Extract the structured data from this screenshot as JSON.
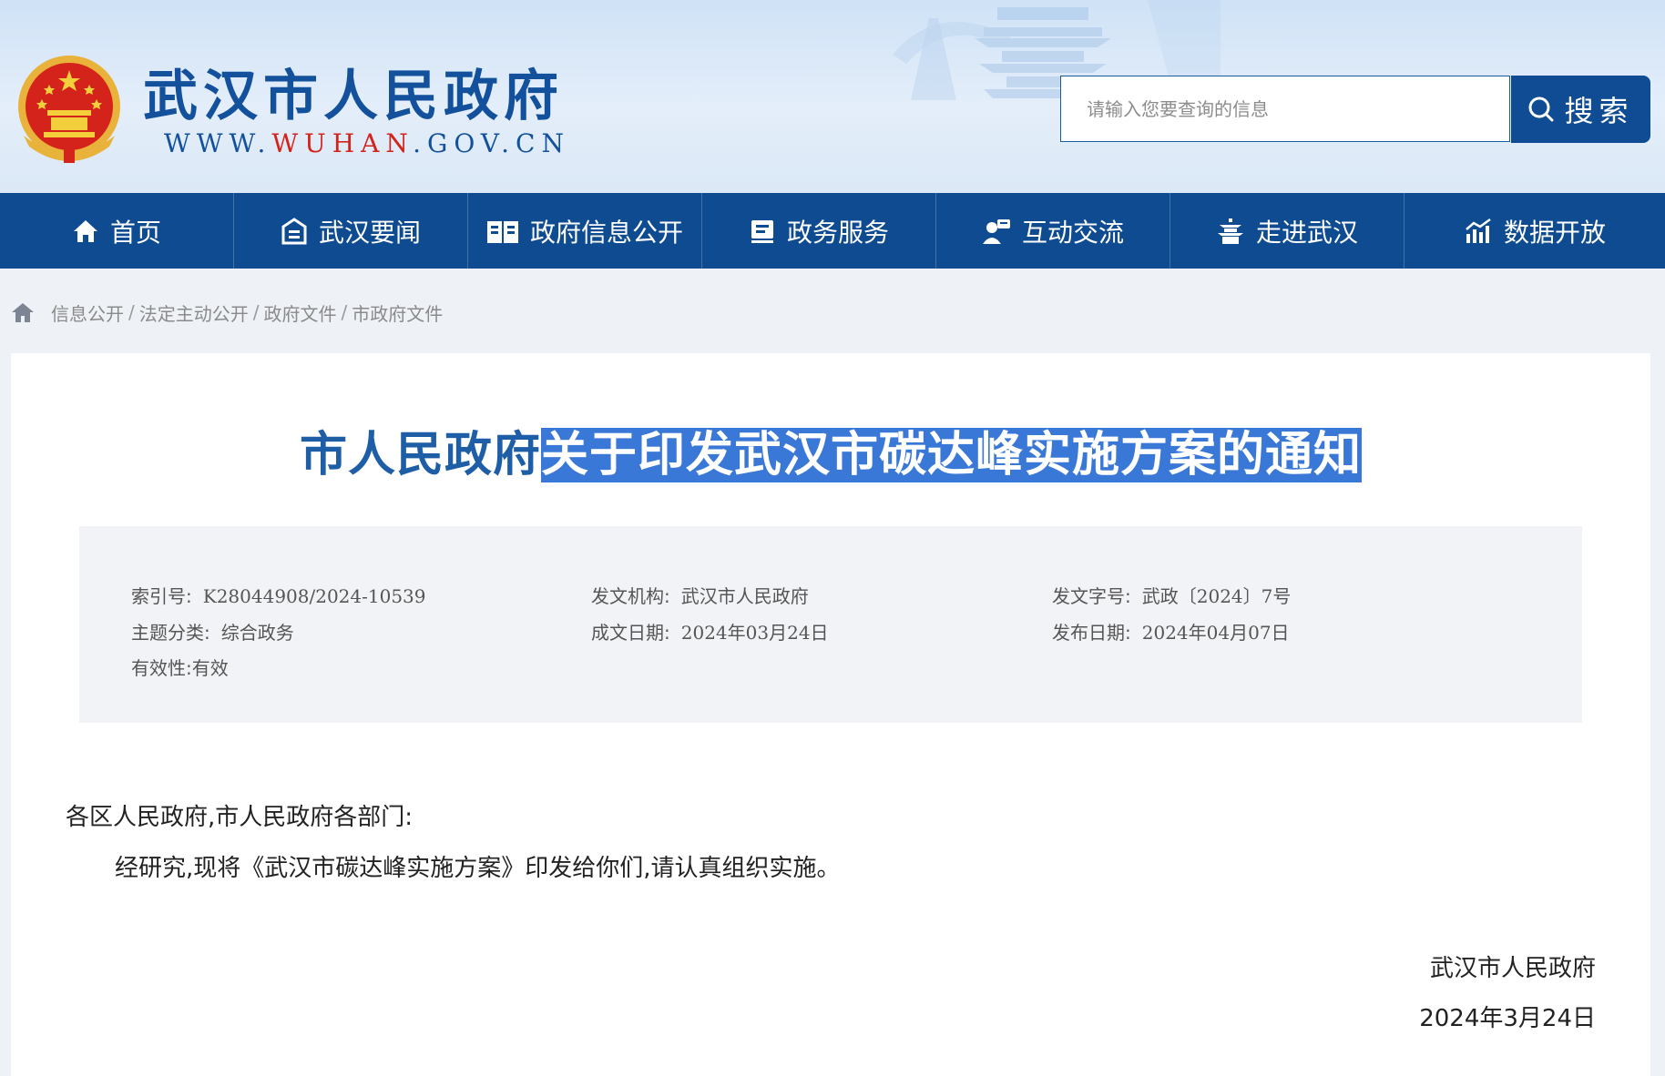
{
  "header": {
    "site_title": "武汉市人民政府",
    "site_url_prefix": "WWW.",
    "site_url_highlight": "WUHAN",
    "site_url_suffix": ".GOV.CN",
    "search": {
      "placeholder": "请输入您要查询的信息",
      "button_label": "搜索"
    }
  },
  "nav": {
    "items": [
      {
        "label": "首页",
        "icon": "home-icon"
      },
      {
        "label": "武汉要闻",
        "icon": "news-icon"
      },
      {
        "label": "政府信息公开",
        "icon": "info-book-icon"
      },
      {
        "label": "政务服务",
        "icon": "service-icon"
      },
      {
        "label": "互动交流",
        "icon": "interaction-icon"
      },
      {
        "label": "走进武汉",
        "icon": "tower-icon"
      },
      {
        "label": "数据开放",
        "icon": "data-chart-icon"
      }
    ]
  },
  "breadcrumb": {
    "items": [
      "信息公开",
      "法定主动公开",
      "政府文件",
      "市政府文件"
    ],
    "separator": "/"
  },
  "document": {
    "title_part1": "市人民政府",
    "title_part2_selected": "关于印发武汉市碳达峰实施方案的通知",
    "meta": {
      "index_no_label": "索引号:",
      "index_no_value": "K28044908/2024-10539",
      "issuer_label": "发文机构:",
      "issuer_value": "武汉市人民政府",
      "doc_no_label": "发文字号:",
      "doc_no_value": "武政〔2024〕7号",
      "category_label": "主题分类:",
      "category_value": "综合政务",
      "created_label": "成文日期:",
      "created_value": "2024年03月24日",
      "published_label": "发布日期:",
      "published_value": "2024年04月07日",
      "validity_label": "有效性:",
      "validity_value": "有效"
    },
    "salutation": "各区人民政府,市人民政府各部门:",
    "paragraph": "经研究,现将《武汉市碳达峰实施方案》印发给你们,请认真组织实施。",
    "signature": "武汉市人民政府",
    "date": "2024年3月24日"
  },
  "colors": {
    "brand_blue": "#0e4b91",
    "title_blue": "#1e5ea6",
    "emblem_red": "#d4231a",
    "selection": "#3a78d8"
  }
}
